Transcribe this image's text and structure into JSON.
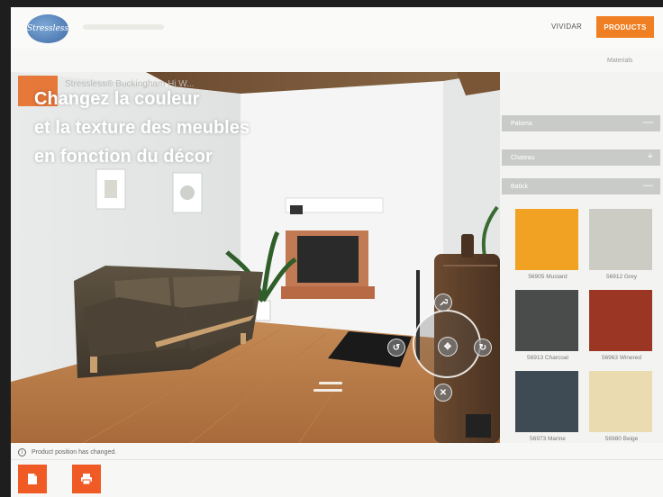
{
  "header": {
    "logo_text": "Stressless",
    "nav": {
      "vividar": "VIVIDAR",
      "products": "PRODUCTS"
    },
    "subtab": "Materials"
  },
  "product": {
    "title": "Stressless® Buckingham Hi W..."
  },
  "headline": {
    "line1": "Changez la couleur",
    "line2": "et la texture des meubles",
    "line3": "en fonction du décor"
  },
  "panel": {
    "sections": [
      {
        "label": "Paloma",
        "symbol": "—"
      },
      {
        "label": "Chateau",
        "symbol": "+"
      },
      {
        "label": "Batick",
        "symbol": "—"
      }
    ],
    "swatches": [
      {
        "label": "56905 Mustard",
        "color": "#f2a223"
      },
      {
        "label": "56912 Grey",
        "color": "#ccccc4"
      },
      {
        "label": "56913 Charcoal",
        "color": "#4a4b4b"
      },
      {
        "label": "56963 Winered",
        "color": "#9b3524"
      },
      {
        "label": "56973 Marine",
        "color": "#3e4a54"
      },
      {
        "label": "56980 Beige",
        "color": "#eadcb0"
      }
    ]
  },
  "status": {
    "message": "Product position has changed."
  },
  "colors": {
    "accent": "#f07e22",
    "action": "#ef5a25"
  },
  "icons": [
    "info-icon",
    "document-icon",
    "print-icon",
    "wrench-icon",
    "rotate-left-icon",
    "rotate-right-icon",
    "move-icon",
    "close-icon"
  ]
}
